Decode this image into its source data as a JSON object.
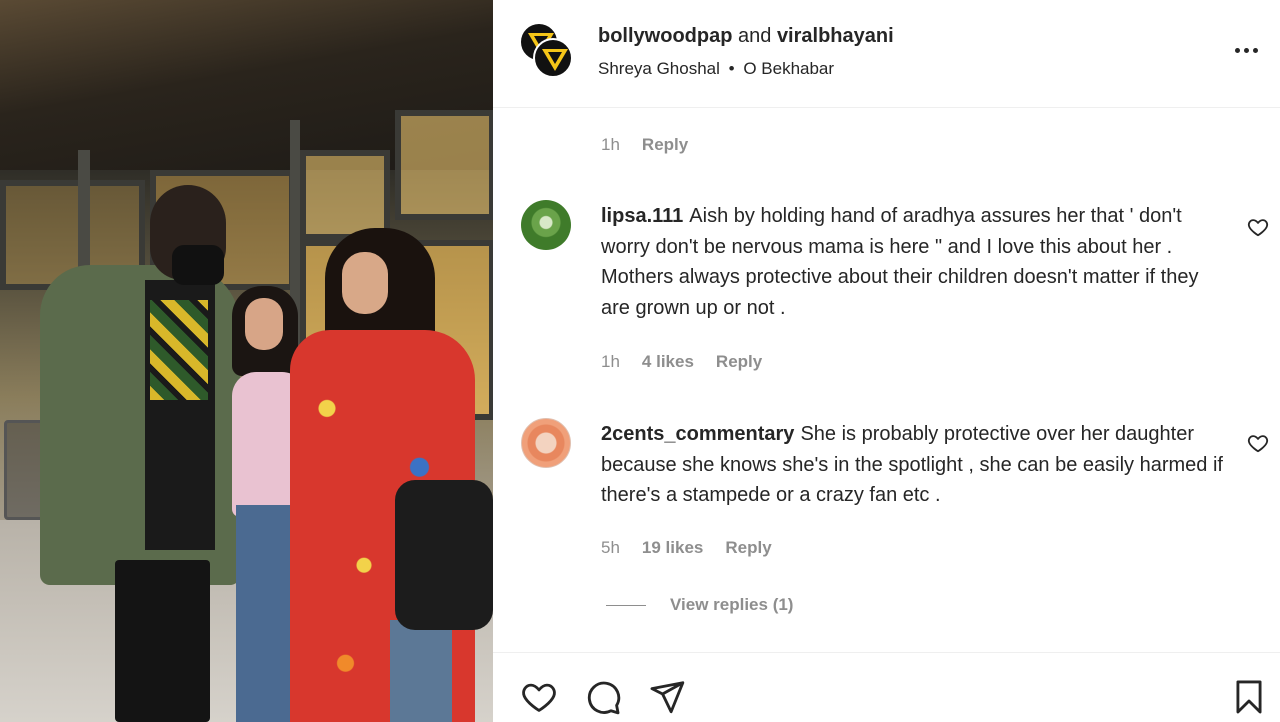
{
  "post": {
    "owner_primary": "bollywoodpap",
    "owner_joiner": "and",
    "owner_secondary": "viralbhayani",
    "audio_artist": "Shreya Ghoshal",
    "audio_separator": "•",
    "audio_title": "O Bekhabar"
  },
  "prev_comment": {
    "time": "1h",
    "reply_label": "Reply"
  },
  "comments": [
    {
      "username": "lipsa.111",
      "text": "Aish by holding hand of aradhya assures her that ' don't worry don't be nervous mama is here \" and I love this about her . Mothers always protective about their children doesn't matter if they are grown up or not .",
      "time": "1h",
      "likes": "4 likes",
      "reply_label": "Reply"
    },
    {
      "username": "2cents_commentary",
      "text": "She is probably protective over her daughter because she knows she's in the spotlight , she can be easily harmed if there's a stampede or a crazy fan etc .",
      "time": "5h",
      "likes": "19 likes",
      "reply_label": "Reply"
    }
  ],
  "view_replies": "View replies (1)",
  "icons": {
    "more": "more-options-icon",
    "like": "heart-icon",
    "comment": "comment-icon",
    "share": "send-icon",
    "save": "bookmark-icon"
  },
  "colors": {
    "text": "#262626",
    "muted": "#8e8e8e",
    "divider": "#efefef"
  }
}
